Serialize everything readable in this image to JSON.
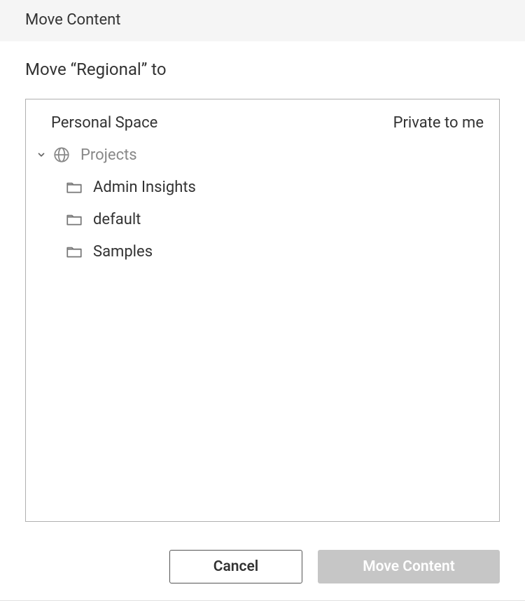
{
  "header": {
    "title": "Move Content"
  },
  "prompt": "Move “Regional” to",
  "tree": {
    "personal": {
      "label": "Personal Space",
      "suffix": "Private to me"
    },
    "projects": {
      "label": "Projects",
      "children": [
        {
          "label": "Admin Insights"
        },
        {
          "label": "default"
        },
        {
          "label": "Samples"
        }
      ]
    }
  },
  "footer": {
    "cancel": "Cancel",
    "primary": "Move Content"
  }
}
